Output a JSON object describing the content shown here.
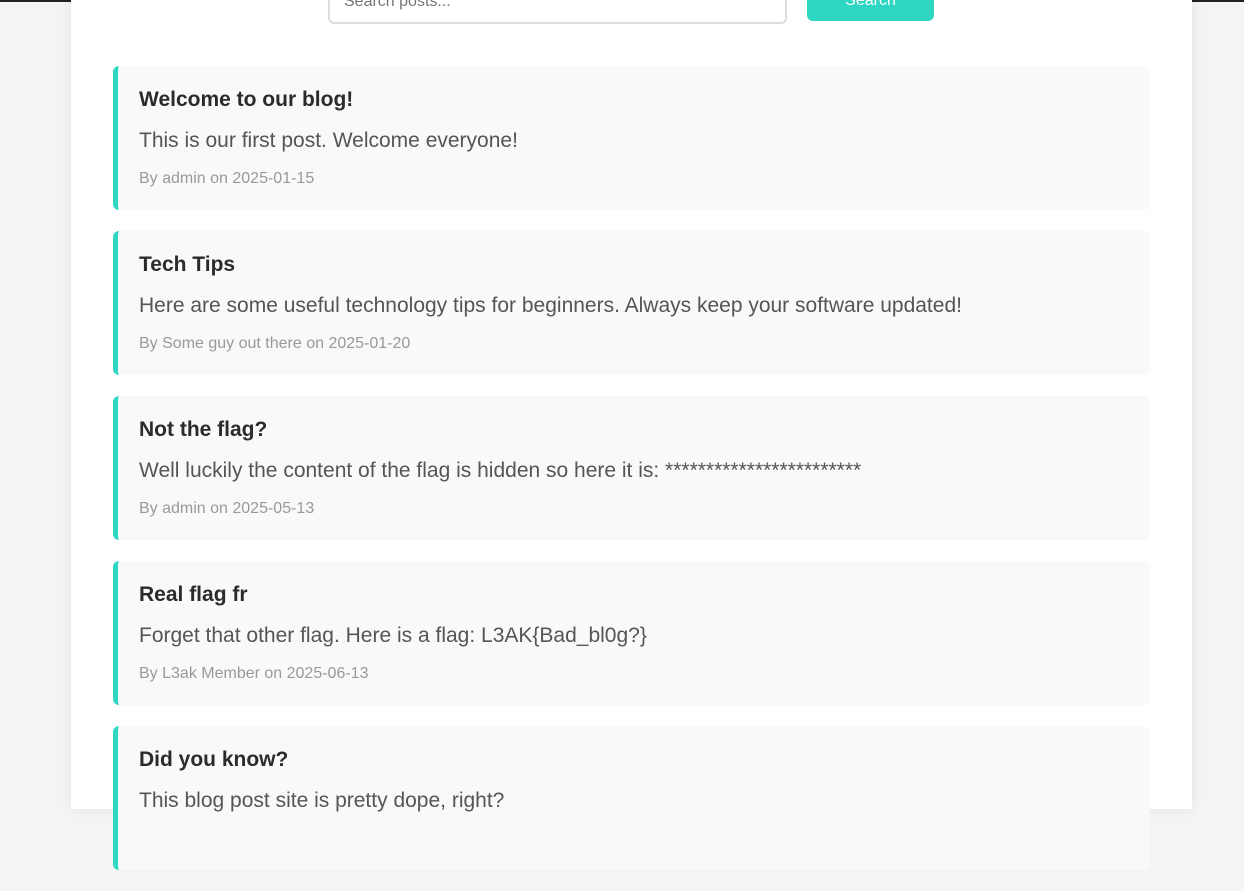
{
  "search": {
    "placeholder": "Search posts...",
    "button_label": "Search"
  },
  "posts": [
    {
      "title": "Welcome to our blog!",
      "content": "This is our first post. Welcome everyone!",
      "meta": "By admin on 2025-01-15"
    },
    {
      "title": "Tech Tips",
      "content": "Here are some useful technology tips for beginners. Always keep your software updated!",
      "meta": "By Some guy out there on 2025-01-20"
    },
    {
      "title": "Not the flag?",
      "content": "Well luckily the content of the flag is hidden so here it is: ************************",
      "meta": "By admin on 2025-05-13"
    },
    {
      "title": "Real flag fr",
      "content": "Forget that other flag. Here is a flag: L3AK{Bad_bl0g?}",
      "meta": "By L3ak Member on 2025-06-13"
    },
    {
      "title": "Did you know?",
      "content": "This blog post site is pretty dope, right?",
      "meta": ""
    }
  ],
  "colors": {
    "accent": "#2fd6c2",
    "card_bg": "#f8f9fa",
    "page_bg": "#f4f4f4"
  }
}
